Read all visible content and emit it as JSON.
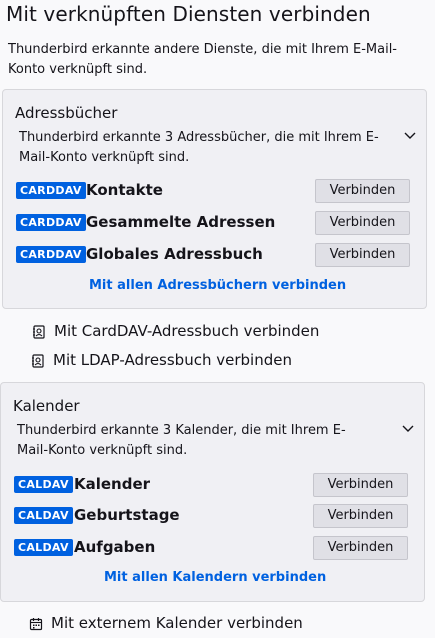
{
  "heading": "Mit verknüpften Diensten verbinden",
  "intro": "Thunderbird erkannte andere Dienste, die mit Ihrem E-Mail-Konto verknüpft sind.",
  "address_books": {
    "title": "Adressbücher",
    "description": "Thunderbird erkannte 3 Adressbücher, die mit Ihrem E-Mail-Konto verknüpft sind.",
    "items": [
      {
        "badge": "CARDDAV",
        "name": "Kontakte",
        "button": "Verbinden"
      },
      {
        "badge": "CARDDAV",
        "name": "Gesammelte Adressen",
        "button": "Verbinden"
      },
      {
        "badge": "CARDDAV",
        "name": "Globales Adressbuch",
        "button": "Verbinden"
      }
    ],
    "connect_all": "Mit allen Adressbüchern verbinden"
  },
  "address_book_options": [
    {
      "label": "Mit CardDAV-Adressbuch verbinden",
      "icon": "address-book-icon"
    },
    {
      "label": "Mit LDAP-Adressbuch verbinden",
      "icon": "address-book-icon"
    }
  ],
  "calendars": {
    "title": "Kalender",
    "description": "Thunderbird erkannte 3 Kalender, die mit Ihrem E-Mail-Konto verknüpft sind.",
    "items": [
      {
        "badge": "CALDAV",
        "name": "Kalender",
        "button": "Verbinden"
      },
      {
        "badge": "CALDAV",
        "name": "Geburtstage",
        "button": "Verbinden"
      },
      {
        "badge": "CALDAV",
        "name": "Aufgaben",
        "button": "Verbinden"
      }
    ],
    "connect_all": "Mit allen Kalendern verbinden"
  },
  "calendar_options": [
    {
      "label": "Mit externem Kalender verbinden",
      "icon": "calendar-icon"
    }
  ],
  "colors": {
    "accent": "#0061e0",
    "card_bg": "#f0f0f4",
    "page_bg": "#f9f9fb"
  }
}
